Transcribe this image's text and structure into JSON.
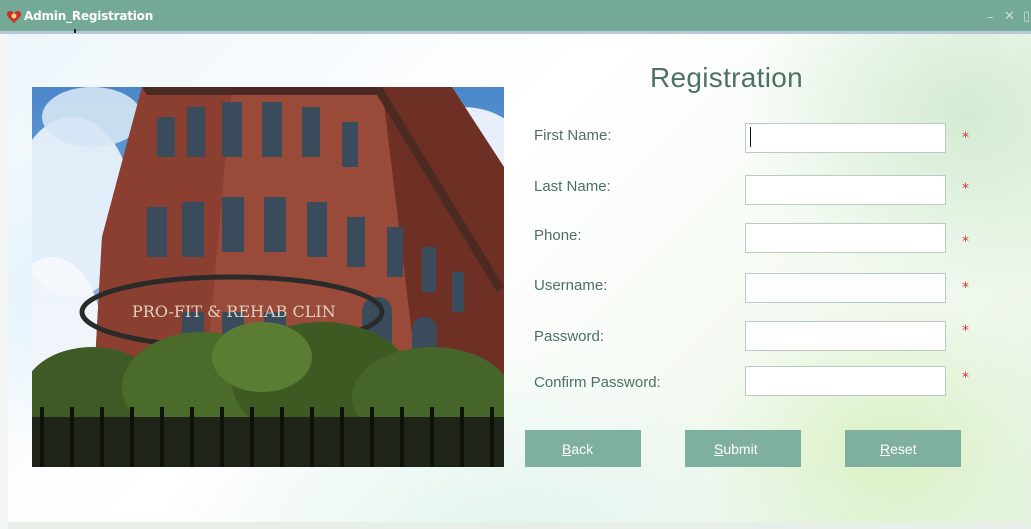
{
  "window": {
    "title": "Admin_Registration",
    "controls": {
      "minimize": "–",
      "close": "✕",
      "maximize": "▯"
    }
  },
  "form": {
    "heading": "Registration",
    "fields": [
      {
        "label": "First Name:",
        "value": "",
        "required_mark": "*"
      },
      {
        "label": "Last Name:",
        "value": "",
        "required_mark": "*"
      },
      {
        "label": "Phone:",
        "value": "",
        "required_mark": "*"
      },
      {
        "label": "Username:",
        "value": "",
        "required_mark": "*"
      },
      {
        "label": "Password:",
        "value": "",
        "required_mark": "*"
      },
      {
        "label": "Confirm Password:",
        "value": "",
        "required_mark": "*"
      }
    ]
  },
  "buttons": {
    "back": {
      "mnemonic": "B",
      "rest": "ack"
    },
    "submit": {
      "mnemonic": "S",
      "rest": "ubmit"
    },
    "reset": {
      "mnemonic": "R",
      "rest": "eset"
    }
  },
  "photo": {
    "description_icon": "building-photo",
    "sign_text": "PRO-FIT & REHAB CLIN"
  },
  "colors": {
    "titlebar": "#74a996",
    "button": "#7eaf9f",
    "heading": "#4d7263",
    "required": "#d4382f"
  }
}
